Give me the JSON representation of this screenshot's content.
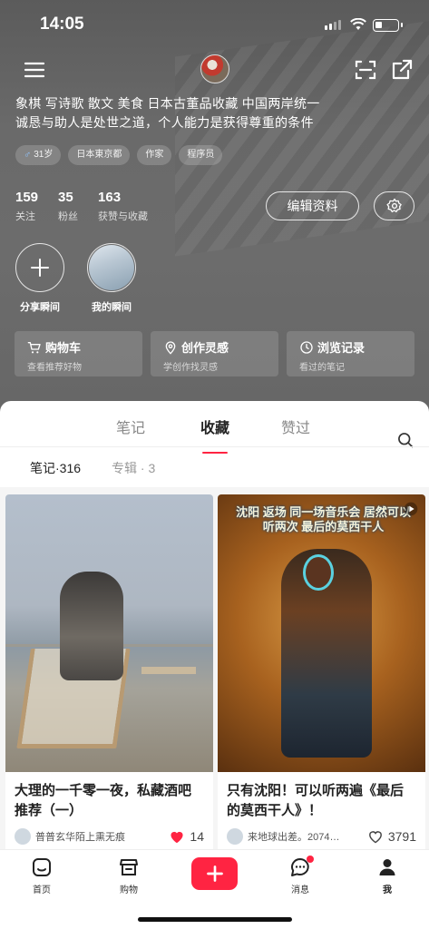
{
  "status_bar": {
    "time": "14:05",
    "battery_level": 0.3
  },
  "profile": {
    "bio_line1": "象棋  写诗歌  散文  美食  日本古董品收藏  中国两岸统一",
    "bio_line2": "诚恳与助人是处世之道，个人能力是获得尊重的条件",
    "tags": [
      {
        "label": "31岁",
        "icon": "male-icon"
      },
      {
        "label": "日本東京都"
      },
      {
        "label": "作家"
      },
      {
        "label": "程序员"
      }
    ],
    "stats": [
      {
        "number": "159",
        "label": "关注"
      },
      {
        "number": "35",
        "label": "粉丝"
      },
      {
        "number": "163",
        "label": "获赞与收藏"
      }
    ],
    "edit_button": "编辑资料"
  },
  "moments": [
    {
      "label": "分享瞬间",
      "icon": "plus-icon"
    },
    {
      "label": "我的瞬间"
    }
  ],
  "quick_cards": [
    {
      "title": "购物车",
      "subtitle": "查看推荐好物",
      "icon": "cart-icon"
    },
    {
      "title": "创作灵感",
      "subtitle": "学创作找灵感",
      "icon": "location-pin-icon"
    },
    {
      "title": "浏览记录",
      "subtitle": "看过的笔记",
      "icon": "clock-icon"
    }
  ],
  "tabs": [
    "笔记",
    "收藏",
    "赞过"
  ],
  "active_tab": "收藏",
  "subtabs": [
    "笔记·316",
    "专辑 · 3"
  ],
  "notes": [
    {
      "title": "大理的一千零一夜，私藏酒吧推荐（一）",
      "author": "普普玄华陌上熏无痕",
      "likes": "14",
      "liked": true
    },
    {
      "title": "只有沈阳！可以听两遍《最后的莫西干人》！",
      "author": "来地球出差。2074…",
      "likes": "3791",
      "liked": false,
      "image_caption": "沈阳 返场 同一场音乐会 居然可以听两次 最后的莫西干人"
    }
  ],
  "bottom_nav": [
    {
      "label": "首页",
      "icon": "home-icon"
    },
    {
      "label": "购物",
      "icon": "shop-icon"
    },
    {
      "label": "",
      "icon": "plus-icon"
    },
    {
      "label": "消息",
      "icon": "message-icon",
      "badge": true
    },
    {
      "label": "我",
      "icon": "person-icon"
    }
  ],
  "colors": {
    "accent": "#ff2442",
    "hero_bg": "#666666"
  }
}
